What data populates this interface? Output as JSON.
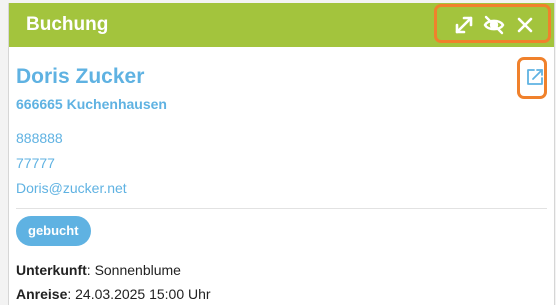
{
  "panel": {
    "title": "Buchung",
    "actions": [
      {
        "icon": "expand-icon",
        "label": "expand"
      },
      {
        "icon": "eye-off-icon",
        "label": "hide"
      },
      {
        "icon": "close-icon",
        "label": "close"
      }
    ],
    "highlight_color": "#f0812c",
    "header_color": "#a3c43d",
    "accent_color": "#5fb2e2"
  },
  "guest": {
    "name": "Doris Zucker",
    "address": "666665 Kuchenhausen",
    "phone1": "888888",
    "phone2": "77777",
    "email": "Doris@zucker.net",
    "edit_icon": "external-edit-icon"
  },
  "booking": {
    "status": "gebucht",
    "accommodation_label": "Unterkunft",
    "accommodation_value": "Sonnenblume",
    "arrival_label": "Anreise",
    "arrival_value": "24.03.2025 15:00 Uhr"
  }
}
